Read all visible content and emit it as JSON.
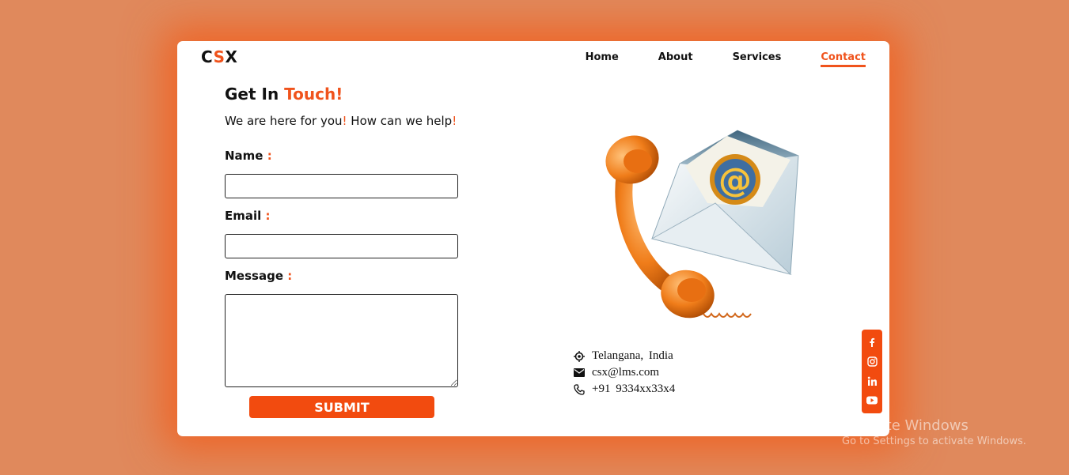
{
  "brand": {
    "logo_pre": "C",
    "logo_accent": "S",
    "logo_post": "X"
  },
  "nav": {
    "items": [
      {
        "label": "Home"
      },
      {
        "label": "About"
      },
      {
        "label": "Services"
      },
      {
        "label": "Contact",
        "active": true
      }
    ]
  },
  "hero": {
    "title_plain": "Get In ",
    "title_accent": "Touch!",
    "subtitle_a": "We are here for you",
    "subtitle_mark1": "!",
    "subtitle_b": " How can we help",
    "subtitle_mark2": "!"
  },
  "form": {
    "name_label": "Name",
    "email_label": "Email",
    "message_label": "Message",
    "colon": ":",
    "name_value": "",
    "email_value": "",
    "message_value": "",
    "submit_label": "SUBMIT"
  },
  "contact": {
    "location": "Telangana,  India",
    "email": "csx@lms.com",
    "phone": "+91  9334xx33x4"
  },
  "social": [
    "facebook-icon",
    "instagram-icon",
    "linkedin-icon",
    "youtube-icon"
  ],
  "watermark": {
    "line1": "Activate Windows",
    "line2": "Go to Settings to activate Windows."
  },
  "colors": {
    "accent": "#f0531c",
    "button": "#f24b0f",
    "page_bg": "#e0895c"
  }
}
